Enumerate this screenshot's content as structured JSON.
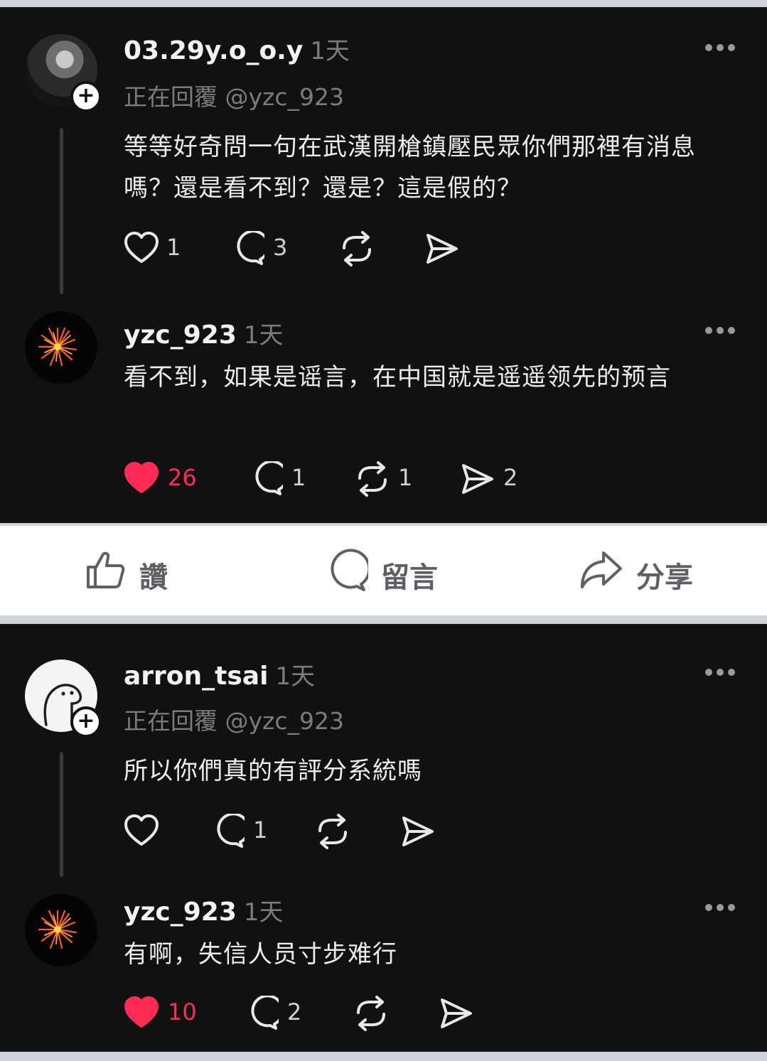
{
  "posts": [
    {
      "username": "03.29y.o_o.y",
      "time": "1天",
      "replying": "正在回覆 @yzc_923",
      "text": "等等好奇問一句在武漢開槍鎮壓民眾你們那裡有消息嗎？還是看不到？還是？這是假的？",
      "likes": "1",
      "comments": "3",
      "reposts": "",
      "shares": "",
      "liked": false
    },
    {
      "username": "yzc_923",
      "time": "1天",
      "text": "看不到，如果是谣言，在中国就是遥遥领先的预言",
      "likes": "26",
      "comments": "1",
      "reposts": "1",
      "shares": "2",
      "liked": true
    },
    {
      "username": "arron_tsai",
      "time": "1天",
      "replying": "正在回覆 @yzc_923",
      "text": "所以你們真的有評分系統嗎",
      "likes": "",
      "comments": "1",
      "reposts": "",
      "shares": "",
      "liked": false
    },
    {
      "username": "yzc_923",
      "time": "1天",
      "text": "有啊，失信人员寸步难行",
      "likes": "10",
      "comments": "2",
      "reposts": "",
      "shares": "",
      "liked": true
    }
  ],
  "facebook_bar": {
    "like_label": "讚",
    "comment_label": "留言",
    "share_label": "分享"
  },
  "colors": {
    "background": "#111112",
    "liked": "#ff2b55",
    "muted": "#7b7b7f",
    "fb_gray": "#5e6065"
  },
  "icons": [
    "heart-icon",
    "comment-icon",
    "repost-icon",
    "share-icon",
    "more-icon",
    "follow-plus-icon",
    "thumbs-up-icon"
  ]
}
